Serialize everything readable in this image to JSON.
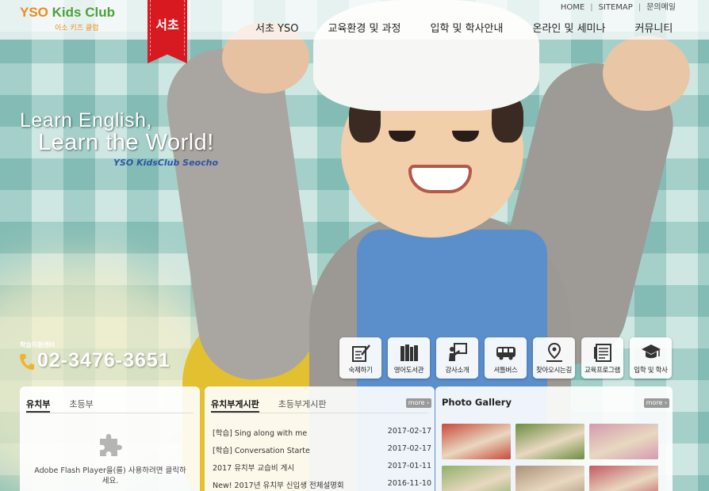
{
  "header": {
    "logo_title": "YSO Kids Club",
    "logo_subtitle": "이소 키즈 클럽",
    "branch": "서초",
    "util_links": [
      "HOME",
      "SITEMAP",
      "문의메일"
    ],
    "nav": [
      "서초 YSO",
      "교육환경 및 과정",
      "입학 및 학사안내",
      "온라인 및 세미나",
      "커뮤니티"
    ]
  },
  "hero": {
    "slogan_line1": "Learn English,",
    "slogan_line2": "Learn the World!",
    "slogan_brand": "YSO KidsClub Seocho",
    "phone_label": "학습지원센터",
    "phone_number": "02-3476-3651"
  },
  "quick_menu": [
    {
      "label": "숙제하기",
      "icon": "homework-icon"
    },
    {
      "label": "영어도서관",
      "icon": "library-books-icon"
    },
    {
      "label": "강사소개",
      "icon": "teacher-board-icon"
    },
    {
      "label": "셔틀버스",
      "icon": "bus-icon"
    },
    {
      "label": "찾아오시는길",
      "icon": "map-pin-icon"
    },
    {
      "label": "교육프로그램",
      "icon": "program-document-icon"
    },
    {
      "label": "입학 및 학사",
      "icon": "graduation-cap-icon"
    }
  ],
  "panel_video": {
    "tabs": [
      "유치부",
      "초등부"
    ],
    "flash_message": "Adobe Flash Player을(를) 사용하려면 클릭하세요."
  },
  "panel_board": {
    "tabs": [
      "유치부게시판",
      "초등부게시판"
    ],
    "more": "more",
    "posts": [
      {
        "title": "[학습] Sing along with me",
        "date": "2017-02-17"
      },
      {
        "title": "[학습] Conversation Starte",
        "date": "2017-02-17"
      },
      {
        "title": "2017 유치부 교습비 게시",
        "date": "2017-01-11"
      },
      {
        "title": "New! 2017년 유치부 신입생 전체설명회",
        "date": "2016-11-10"
      }
    ]
  },
  "panel_gallery": {
    "title": "Photo Gallery",
    "more": "more",
    "thumb_colors": [
      "#c94a3a",
      "#6c8d3f",
      "#d59ab0",
      "#8fb06a",
      "#a89278",
      "#c45a62"
    ]
  },
  "colors": {
    "logo_orange": "#f08a1a",
    "logo_green": "#4aa23a",
    "ribbon_red": "#d71920",
    "brand_blue": "#2e55a6"
  }
}
